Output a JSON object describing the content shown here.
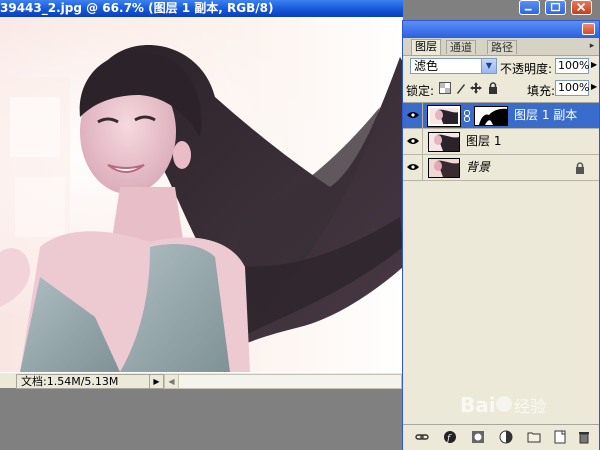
{
  "document": {
    "title": "39443_2.jpg @ 66.7% (图层 1 副本, RGB/8)",
    "status_text": "文档:1.54M/5.13M"
  },
  "layers_panel": {
    "tabs": [
      "图层",
      "通道",
      "路径"
    ],
    "active_tab": 0,
    "blend_mode": "滤色",
    "opacity_label": "不透明度:",
    "opacity_value": "100%",
    "lock_label": "锁定:",
    "fill_label": "填充:",
    "fill_value": "100%",
    "layers": [
      {
        "name": "图层 1 副本",
        "visible": true,
        "selected": true,
        "has_mask": true
      },
      {
        "name": "图层 1",
        "visible": true,
        "selected": false,
        "has_mask": false
      },
      {
        "name": "背景",
        "visible": true,
        "selected": false,
        "locked": true,
        "italic": true
      }
    ],
    "selection_color": "#3a6ccc"
  },
  "watermark": {
    "text": "Baidu经验"
  },
  "colors": {
    "titlebar_blue": "#1657d8",
    "panel_bg": "#ece9d8",
    "workspace_gray": "#808080"
  }
}
